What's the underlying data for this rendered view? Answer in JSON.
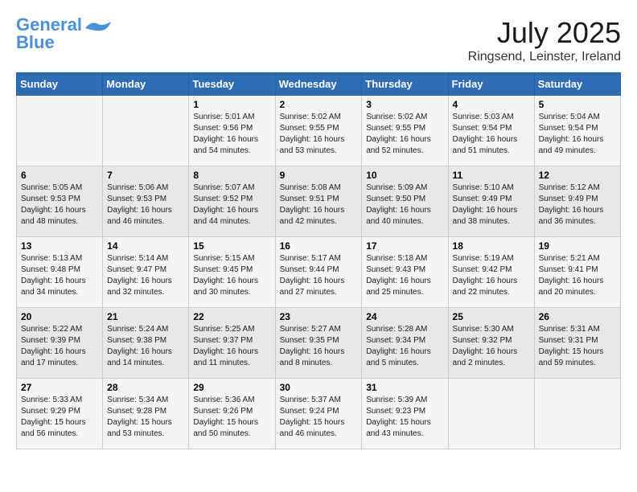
{
  "logo": {
    "line1": "General",
    "line2": "Blue"
  },
  "title": "July 2025",
  "location": "Ringsend, Leinster, Ireland",
  "headers": [
    "Sunday",
    "Monday",
    "Tuesday",
    "Wednesday",
    "Thursday",
    "Friday",
    "Saturday"
  ],
  "weeks": [
    [
      {
        "day": "",
        "info": ""
      },
      {
        "day": "",
        "info": ""
      },
      {
        "day": "1",
        "info": "Sunrise: 5:01 AM\nSunset: 9:56 PM\nDaylight: 16 hours and 54 minutes."
      },
      {
        "day": "2",
        "info": "Sunrise: 5:02 AM\nSunset: 9:55 PM\nDaylight: 16 hours and 53 minutes."
      },
      {
        "day": "3",
        "info": "Sunrise: 5:02 AM\nSunset: 9:55 PM\nDaylight: 16 hours and 52 minutes."
      },
      {
        "day": "4",
        "info": "Sunrise: 5:03 AM\nSunset: 9:54 PM\nDaylight: 16 hours and 51 minutes."
      },
      {
        "day": "5",
        "info": "Sunrise: 5:04 AM\nSunset: 9:54 PM\nDaylight: 16 hours and 49 minutes."
      }
    ],
    [
      {
        "day": "6",
        "info": "Sunrise: 5:05 AM\nSunset: 9:53 PM\nDaylight: 16 hours and 48 minutes."
      },
      {
        "day": "7",
        "info": "Sunrise: 5:06 AM\nSunset: 9:53 PM\nDaylight: 16 hours and 46 minutes."
      },
      {
        "day": "8",
        "info": "Sunrise: 5:07 AM\nSunset: 9:52 PM\nDaylight: 16 hours and 44 minutes."
      },
      {
        "day": "9",
        "info": "Sunrise: 5:08 AM\nSunset: 9:51 PM\nDaylight: 16 hours and 42 minutes."
      },
      {
        "day": "10",
        "info": "Sunrise: 5:09 AM\nSunset: 9:50 PM\nDaylight: 16 hours and 40 minutes."
      },
      {
        "day": "11",
        "info": "Sunrise: 5:10 AM\nSunset: 9:49 PM\nDaylight: 16 hours and 38 minutes."
      },
      {
        "day": "12",
        "info": "Sunrise: 5:12 AM\nSunset: 9:49 PM\nDaylight: 16 hours and 36 minutes."
      }
    ],
    [
      {
        "day": "13",
        "info": "Sunrise: 5:13 AM\nSunset: 9:48 PM\nDaylight: 16 hours and 34 minutes."
      },
      {
        "day": "14",
        "info": "Sunrise: 5:14 AM\nSunset: 9:47 PM\nDaylight: 16 hours and 32 minutes."
      },
      {
        "day": "15",
        "info": "Sunrise: 5:15 AM\nSunset: 9:45 PM\nDaylight: 16 hours and 30 minutes."
      },
      {
        "day": "16",
        "info": "Sunrise: 5:17 AM\nSunset: 9:44 PM\nDaylight: 16 hours and 27 minutes."
      },
      {
        "day": "17",
        "info": "Sunrise: 5:18 AM\nSunset: 9:43 PM\nDaylight: 16 hours and 25 minutes."
      },
      {
        "day": "18",
        "info": "Sunrise: 5:19 AM\nSunset: 9:42 PM\nDaylight: 16 hours and 22 minutes."
      },
      {
        "day": "19",
        "info": "Sunrise: 5:21 AM\nSunset: 9:41 PM\nDaylight: 16 hours and 20 minutes."
      }
    ],
    [
      {
        "day": "20",
        "info": "Sunrise: 5:22 AM\nSunset: 9:39 PM\nDaylight: 16 hours and 17 minutes."
      },
      {
        "day": "21",
        "info": "Sunrise: 5:24 AM\nSunset: 9:38 PM\nDaylight: 16 hours and 14 minutes."
      },
      {
        "day": "22",
        "info": "Sunrise: 5:25 AM\nSunset: 9:37 PM\nDaylight: 16 hours and 11 minutes."
      },
      {
        "day": "23",
        "info": "Sunrise: 5:27 AM\nSunset: 9:35 PM\nDaylight: 16 hours and 8 minutes."
      },
      {
        "day": "24",
        "info": "Sunrise: 5:28 AM\nSunset: 9:34 PM\nDaylight: 16 hours and 5 minutes."
      },
      {
        "day": "25",
        "info": "Sunrise: 5:30 AM\nSunset: 9:32 PM\nDaylight: 16 hours and 2 minutes."
      },
      {
        "day": "26",
        "info": "Sunrise: 5:31 AM\nSunset: 9:31 PM\nDaylight: 15 hours and 59 minutes."
      }
    ],
    [
      {
        "day": "27",
        "info": "Sunrise: 5:33 AM\nSunset: 9:29 PM\nDaylight: 15 hours and 56 minutes."
      },
      {
        "day": "28",
        "info": "Sunrise: 5:34 AM\nSunset: 9:28 PM\nDaylight: 15 hours and 53 minutes."
      },
      {
        "day": "29",
        "info": "Sunrise: 5:36 AM\nSunset: 9:26 PM\nDaylight: 15 hours and 50 minutes."
      },
      {
        "day": "30",
        "info": "Sunrise: 5:37 AM\nSunset: 9:24 PM\nDaylight: 15 hours and 46 minutes."
      },
      {
        "day": "31",
        "info": "Sunrise: 5:39 AM\nSunset: 9:23 PM\nDaylight: 15 hours and 43 minutes."
      },
      {
        "day": "",
        "info": ""
      },
      {
        "day": "",
        "info": ""
      }
    ]
  ]
}
